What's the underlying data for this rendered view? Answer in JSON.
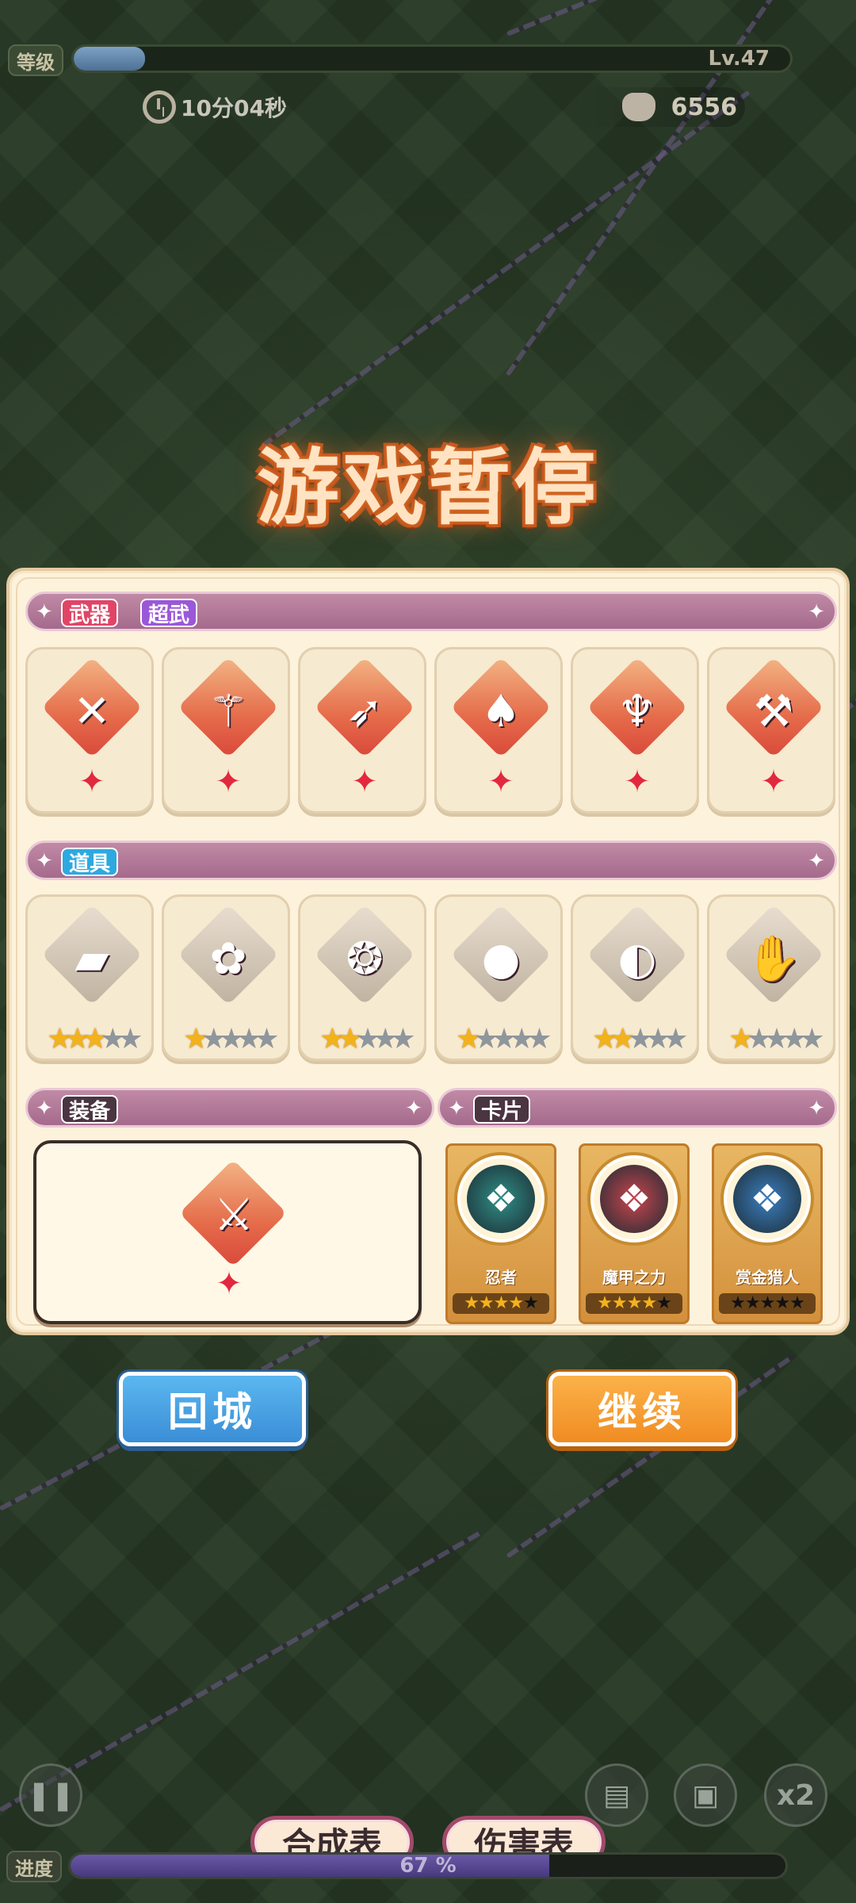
{
  "hud": {
    "level_label": "等级",
    "level_text": "Lv.47",
    "level_progress": 0.1,
    "timer": "10分04秒",
    "kill_count": "6556"
  },
  "title": "游戏暂停",
  "sections": {
    "weapons": {
      "tag1": "武器",
      "tag2": "超武"
    },
    "items": {
      "tag": "道具"
    },
    "equipment": {
      "tag": "装备"
    },
    "cards": {
      "tag": "卡片"
    }
  },
  "weapons": [
    {
      "icon": "crossed-swords-icon",
      "glyph": "✕"
    },
    {
      "icon": "feather-staff-icon",
      "glyph": "⚚"
    },
    {
      "icon": "purple-crossbow-icon",
      "glyph": "➶"
    },
    {
      "icon": "red-demon-icon",
      "glyph": "♠"
    },
    {
      "icon": "trident-icon",
      "glyph": "♆"
    },
    {
      "icon": "axe-icon",
      "glyph": "⚒"
    }
  ],
  "items": [
    {
      "icon": "fire-book-icon",
      "glyph": "▰",
      "stars": 3
    },
    {
      "icon": "pink-spellbook-icon",
      "glyph": "✿",
      "stars": 1
    },
    {
      "icon": "brain-icon",
      "glyph": "❂",
      "stars": 2
    },
    {
      "icon": "purple-potion-icon",
      "glyph": "●",
      "stars": 1
    },
    {
      "icon": "black-pot-icon",
      "glyph": "◐",
      "stars": 2
    },
    {
      "icon": "fire-glove-icon",
      "glyph": "✋",
      "stars": 1
    }
  ],
  "equipment": {
    "icon": "sword-scabbard-icon",
    "glyph": "⚔"
  },
  "cards": [
    {
      "name": "忍者",
      "stars": 4,
      "icon": "ninja-card-icon",
      "color": "#2f8e86"
    },
    {
      "name": "魔甲之力",
      "stars": 4,
      "icon": "armor-card-icon",
      "color": "#c8454e"
    },
    {
      "name": "赏金猎人",
      "stars": 0,
      "icon": "hunter-card-icon",
      "color": "#3a7fc0"
    }
  ],
  "buttons": {
    "return": "回城",
    "continue": "继续",
    "speed": "x2",
    "compose": "合成表",
    "damage": "伤害表"
  },
  "progress": {
    "label": "进度",
    "text": "67 %",
    "value": 0.67
  }
}
